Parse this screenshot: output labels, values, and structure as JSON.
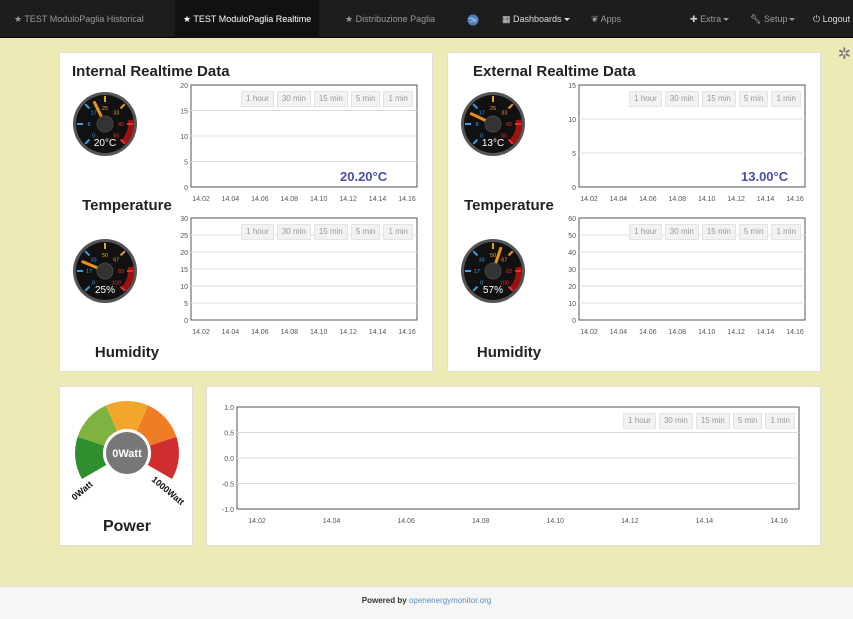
{
  "nav": {
    "items": [
      {
        "label": "★ TEST ModuloPaglia Historical",
        "active": false
      },
      {
        "label": "★ TEST ModuloPaglia Realtime",
        "active": true
      },
      {
        "label": "★ Distribuzione Paglia",
        "active": false
      }
    ],
    "dashboards_label": "Dashboards",
    "apps_label": "Apps",
    "extra_label": "Extra",
    "setup_label": "Setup",
    "logout_label": "Logout"
  },
  "time_buttons": [
    "1 hour",
    "30 min",
    "15 min",
    "5 min",
    "1 min"
  ],
  "x_ticks": [
    "14.02",
    "14.04",
    "14.06",
    "14.08",
    "14.10",
    "14.12",
    "14.14",
    "14.16"
  ],
  "internal": {
    "title": "Internal Realtime Data",
    "temperature": {
      "label": "Temperature",
      "value_text": "20°C",
      "readout": "20.20°C",
      "value": 20.2,
      "gauge_ticks": [
        "0",
        "8",
        "17",
        "25",
        "33",
        "42",
        "50"
      ]
    },
    "humidity": {
      "label": "Humidity",
      "value_text": "25%",
      "value": 25,
      "gauge_ticks": [
        "0",
        "17",
        "33",
        "50",
        "67",
        "83",
        "100"
      ]
    }
  },
  "external": {
    "title": "External Realtime Data",
    "temperature": {
      "label": "Temperature",
      "value_text": "13°C",
      "readout": "13.00°C",
      "value": 13.0,
      "gauge_ticks": [
        "0",
        "8",
        "17",
        "25",
        "33",
        "42",
        "50"
      ]
    },
    "humidity": {
      "label": "Humidity",
      "value_text": "57%",
      "value": 57,
      "gauge_ticks": [
        "0",
        "17",
        "33",
        "50",
        "67",
        "83",
        "100"
      ]
    }
  },
  "power": {
    "label": "Power",
    "center_text": "0Watt",
    "min_text": "0Watt",
    "max_text": "1000Watt",
    "value": 0,
    "colors": [
      "#2f8f2f",
      "#7fb241",
      "#f2a72c",
      "#f07d24",
      "#cf2e2e"
    ]
  },
  "chart_data": [
    {
      "type": "line",
      "id": "int-temp",
      "y_ticks": [
        0,
        5,
        10,
        15,
        20
      ],
      "ylim": [
        0,
        20
      ]
    },
    {
      "type": "line",
      "id": "int-hum",
      "y_ticks": [
        0,
        5,
        10,
        15,
        20,
        25,
        30
      ],
      "ylim": [
        0,
        30
      ]
    },
    {
      "type": "line",
      "id": "ext-temp",
      "y_ticks": [
        0,
        5,
        10,
        15
      ],
      "ylim": [
        0,
        15
      ]
    },
    {
      "type": "line",
      "id": "ext-hum",
      "y_ticks": [
        0,
        10,
        20,
        30,
        40,
        50,
        60
      ],
      "ylim": [
        0,
        60
      ]
    },
    {
      "type": "line",
      "id": "power",
      "y_ticks": [
        -1.0,
        -0.5,
        0.0,
        0.5,
        1.0
      ],
      "y_tick_labels": [
        "-1.0",
        "-0.5",
        "0.0",
        "0.5",
        "1.0"
      ],
      "ylim": [
        -1,
        1
      ]
    }
  ],
  "footer": {
    "prefix": "Powered by",
    "link_text": "openenergymonitor.org"
  }
}
